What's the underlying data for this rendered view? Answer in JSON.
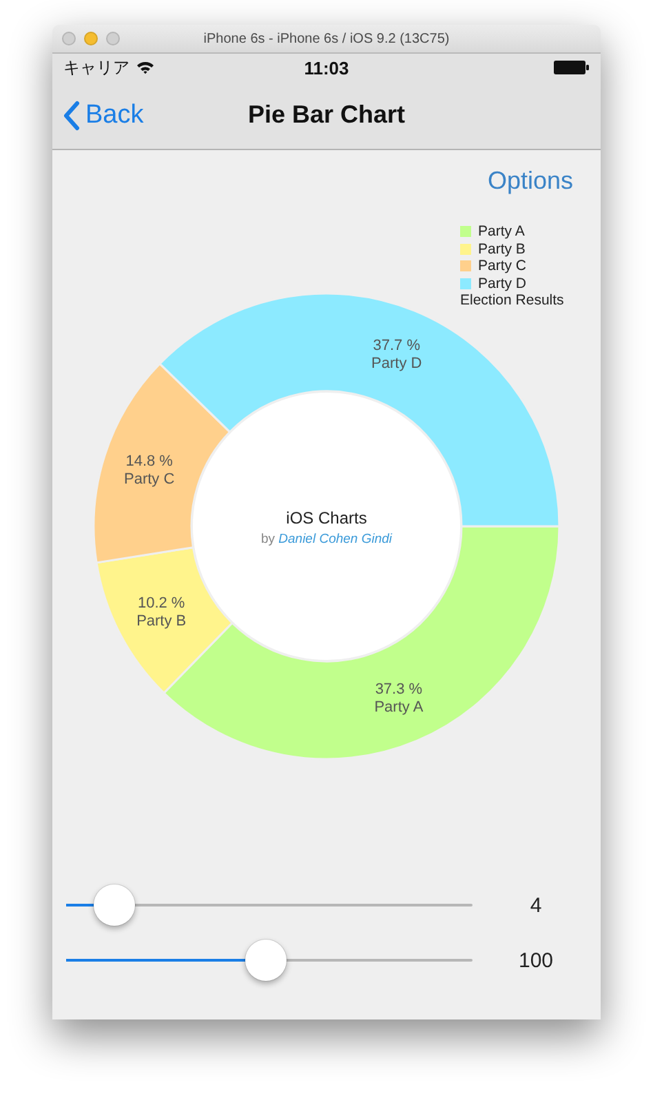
{
  "window": {
    "title": "iPhone 6s - iPhone 6s / iOS 9.2 (13C75)"
  },
  "status_bar": {
    "carrier": "キャリア",
    "time": "11:03"
  },
  "nav_bar": {
    "back": "Back",
    "title": "Pie Bar Chart"
  },
  "options_button": "Options",
  "chart": {
    "legend": {
      "items": [
        {
          "label": "Party A",
          "color": "#c1ff8c"
        },
        {
          "label": "Party B",
          "color": "#fff48c"
        },
        {
          "label": "Party C",
          "color": "#ffd08c"
        },
        {
          "label": "Party D",
          "color": "#8ceaff"
        }
      ],
      "title": "Election Results"
    },
    "center_title": "iOS Charts",
    "center_by": "by",
    "center_author": "Daniel Cohen Gindi",
    "chart_data": {
      "type": "donut",
      "categories": [
        "Party A",
        "Party B",
        "Party C",
        "Party D"
      ],
      "values": [
        37.3,
        10.2,
        14.8,
        37.7
      ],
      "data_labels": true,
      "value_labels": [
        "37.3 %",
        "10.2 %",
        "14.8 %",
        "37.7 %"
      ]
    }
  },
  "sliders": [
    {
      "level": 0.12,
      "reading": "4"
    },
    {
      "level": 0.49,
      "reading": "100"
    }
  ]
}
